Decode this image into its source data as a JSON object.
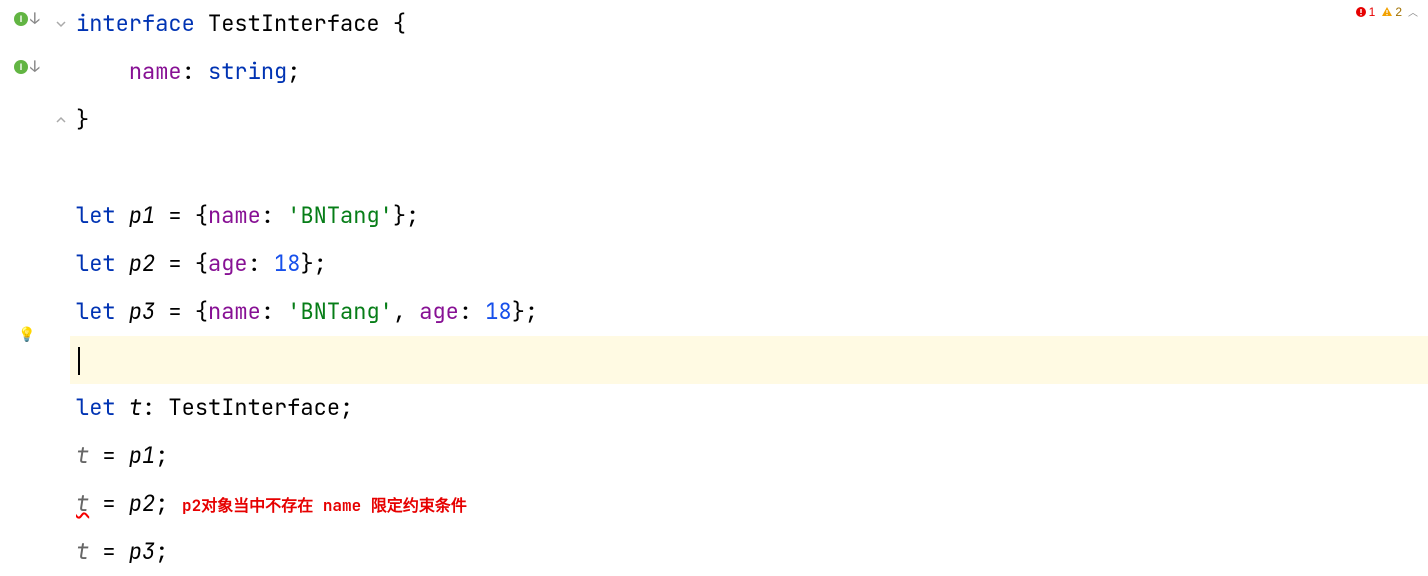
{
  "inspection": {
    "errors": "1",
    "warnings": "2"
  },
  "gutter": {
    "badge": "I"
  },
  "code": {
    "l1": {
      "kw": "interface",
      "name": "TestInterface",
      "open": " {"
    },
    "l2": {
      "indent": "    ",
      "prop": "name",
      "sep": ": ",
      "type": "string",
      "semi": ";"
    },
    "l3": {
      "close": "}"
    },
    "l5": {
      "kw": "let",
      "sp": " ",
      "var": "p1",
      "eq": " = {",
      "prop": "name",
      "sep": ": ",
      "str": "'BNTang'",
      "close": "};"
    },
    "l6": {
      "kw": "let",
      "sp": " ",
      "var": "p2",
      "eq": " = {",
      "prop": "age",
      "sep": ": ",
      "num": "18",
      "close": "};"
    },
    "l7": {
      "kw": "let",
      "sp": " ",
      "var": "p3",
      "eq": " = {",
      "prop1": "name",
      "sep1": ": ",
      "str": "'BNTang'",
      "comma": ", ",
      "prop2": "age",
      "sep2": ": ",
      "num": "18",
      "close": "};"
    },
    "l9": {
      "kw": "let",
      "sp": " ",
      "var": "t",
      "sep": ": ",
      "type": "TestInterface",
      "semi": ";"
    },
    "l10": {
      "var": "t",
      "eq": " = ",
      "rhs": "p1",
      "semi": ";"
    },
    "l11": {
      "var": "t",
      "eq": " = ",
      "rhs": "p2",
      "semi": ";",
      "note": " p2对象当中不存在 name 限定约束条件"
    },
    "l12": {
      "var": "t",
      "eq": " = ",
      "rhs": "p3",
      "semi": ";"
    }
  }
}
